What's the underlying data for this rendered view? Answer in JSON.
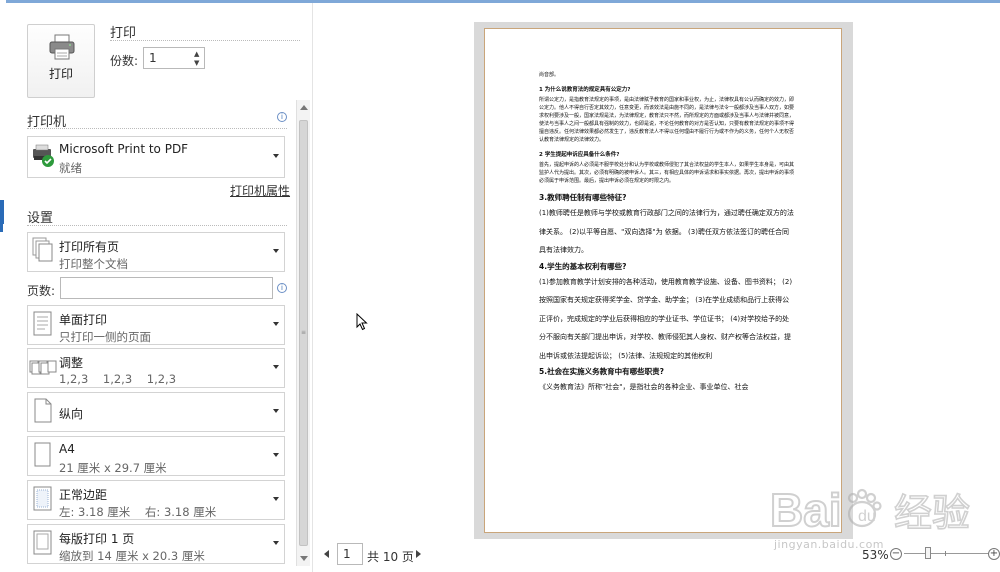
{
  "print": {
    "button_label": "打印",
    "title": "打印",
    "copies_label": "份数:",
    "copies_value": "1"
  },
  "printer": {
    "section_title": "打印机",
    "name": "Microsoft Print to PDF",
    "status": "就绪",
    "properties_link": "打印机属性"
  },
  "settings": {
    "section_title": "设置",
    "pages_label": "页数:",
    "pages_value": "",
    "options": [
      {
        "line1": "打印所有页",
        "line2": "打印整个文档",
        "icon": "pages-icon"
      },
      {
        "line1": "单面打印",
        "line2": "只打印一侧的页面",
        "icon": "one-sided-icon"
      },
      {
        "line1": "调整",
        "line2": "1,2,3    1,2,3    1,2,3",
        "icon": "collate-icon"
      },
      {
        "line1": "纵向",
        "line2": "",
        "icon": "portrait-icon"
      },
      {
        "line1": "A4",
        "line2": "21 厘米 x 29.7 厘米",
        "icon": "paper-size-icon"
      },
      {
        "line1": "正常边距",
        "line2": "左: 3.18 厘米    右: 3.18 厘米",
        "icon": "margins-icon"
      },
      {
        "line1": "每版打印 1 页",
        "line2": "缩放到 14 厘米 x 20.3 厘米",
        "icon": "pages-per-sheet-icon"
      }
    ]
  },
  "preview": {
    "doc_lines": [
      {
        "style": "sm",
        "text": "尚音部。"
      },
      {
        "style": "smh",
        "text": "1 为什么说教育法的规定具有公定力?"
      },
      {
        "style": "sm",
        "text": "所谓公定力，是指教育法规定的事项，是由法律赋予教育的国家和事业权，为止，法律权具有公认而确定的效力，即公定力。他人不得自行否定其效力，任意变更，而该效法是由施不同的，是法律与法令一般都涉及当事人双方，如要求权利要涉及一般，国家法规是法，为法律规定，教育法只不然，而所规定的方面或都涉及当事人与法律并被同意，使法与当事人之间一般都具有强制的效力，也即是说，不论任何教育的对方是否认知，只要有教育法规定的事项不得擅自违反。任何法律效果都必然发生了，违反教育法人不得以任何理由不履行行为或不作为的义务，任何个人无权否认教育法律规定的法律效力。"
      },
      {
        "style": "smh",
        "text": "2 学生提起申诉应具备什么条件?"
      },
      {
        "style": "sm",
        "text": "首先，提起申诉的人必须是不服学校处分和认为学校或教师侵犯了其合法权益的学生本人，如果学生本身是，可由其监护人代为提出。其次，必须有明确的被申诉人。其三，有相应具体的申诉请求和事实依据。再次，提出申诉的事项必须属于申诉范围。最后，提出申诉必须在规定的时限之内。"
      },
      {
        "style": "bh",
        "text": "3.教师聘任制有哪些特征?"
      },
      {
        "style": "bp",
        "text": "(1)教师聘任是教师与学校或教育行政部门之间的法律行为，通过聘任确定双方的法律关系。 (2)以平等自愿、\"双向选择\"为 依据。 (3)聘任双方依法签订的聘任合同具有法律效力。"
      },
      {
        "style": "bh",
        "text": "4.学生的基本权利有哪些?"
      },
      {
        "style": "bp",
        "text": "(1)参加教育教学计划安排的各种活动，使用教育教学设施、设备、图书资料； (2)按照国家有关规定获得奖学金、贷学金、助学金； (3)在学业成绩和品行上获得公正评价，完成规定的学业后获得相应的学业证书、学位证书； (4)对学校给予的处分不服向有关部门提出申诉，对学校、教师侵犯其人身权、财产权等合法权益，提出申诉或依法提起诉讼； (5)法律、法规规定的其他权利"
      },
      {
        "style": "bh",
        "text": "5.社会在实施义务教育中有哪些职责?"
      },
      {
        "style": "bp",
        "text": "《义务教育法》所称\"社会\"，是指社会的各种企业、事业单位、社会"
      }
    ]
  },
  "footer": {
    "current_page": "1",
    "total_pages": "共 10 页",
    "zoom": "53%"
  },
  "watermark": {
    "brand": "Baidu经验",
    "url": "jingyan.baidu.com"
  },
  "colors": {
    "accent": "#2a6bb7",
    "page_border": "#c9a57a",
    "preview_shadow": "#d9d9d9"
  }
}
